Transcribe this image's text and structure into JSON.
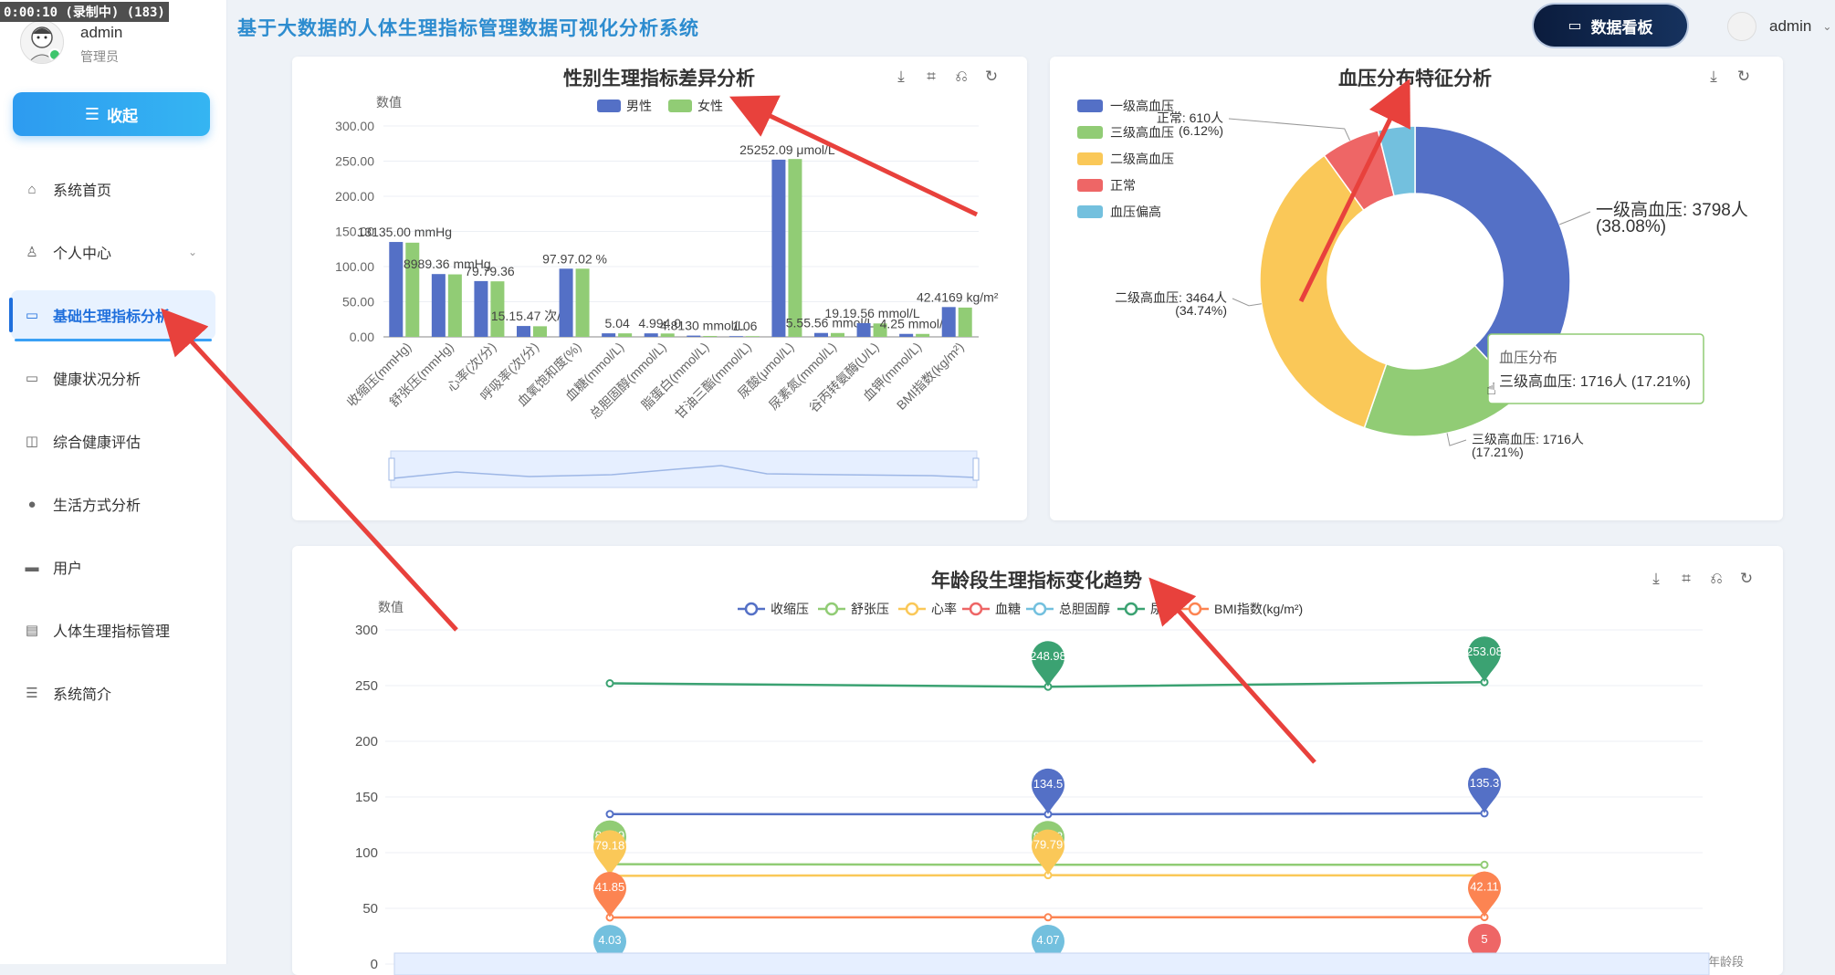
{
  "recording": "0:00:10 (录制中) (183)",
  "sidebar": {
    "user": {
      "name": "admin",
      "role": "管理员"
    },
    "collapse_label": "收起",
    "items": [
      {
        "label": "系统首页",
        "icon": "home-icon"
      },
      {
        "label": "个人中心",
        "icon": "user-icon",
        "has_submenu": true
      },
      {
        "label": "基础生理指标分析",
        "icon": "monitor-icon",
        "active": true
      },
      {
        "label": "健康状况分析",
        "icon": "monitor-icon"
      },
      {
        "label": "综合健康评估",
        "icon": "cup-icon"
      },
      {
        "label": "生活方式分析",
        "icon": "bulb-icon"
      },
      {
        "label": "用户",
        "icon": "briefcase-icon"
      },
      {
        "label": "人体生理指标管理",
        "icon": "document-icon"
      },
      {
        "label": "系统简介",
        "icon": "sliders-icon"
      }
    ]
  },
  "header": {
    "title": "基于大数据的人体生理指标管理数据可视化分析系统",
    "dashboard_button": "数据看板",
    "user_name": "admin"
  },
  "chart_data": [
    {
      "id": "gender",
      "type": "bar",
      "title": "性别生理指标差异分析",
      "ylabel": "数值",
      "ylim": [
        0,
        300
      ],
      "yticks": [
        "0.00",
        "50.00",
        "100.00",
        "150.00",
        "200.00",
        "250.00",
        "300.00"
      ],
      "categories": [
        "收缩压(mmHg)",
        "舒张压(mmHg)",
        "心率(次/分)",
        "呼吸率(次/分)",
        "血氧饱和度(%)",
        "血糖(mmol/L)",
        "总胆固醇(mmol/L)",
        "脂蛋白(mmol/L)",
        "甘油三酯(mmol/L)",
        "尿酸(μmol/L)",
        "尿素氮(mmol/L)",
        "谷丙转氨酶(U/L)",
        "血钾(mmol/L)",
        "BMI指数(kg/m²)"
      ],
      "series": [
        {
          "name": "男性",
          "color": "#5470c6",
          "values": [
            135.0,
            89.36,
            79.36,
            15.47,
            97.02,
            5.04,
            4.99,
            1.81,
            1.06,
            252.09,
            5.56,
            19.56,
            4.25,
            42.41
          ]
        },
        {
          "name": "女性",
          "color": "#91cc75",
          "values": [
            134.0,
            88.9,
            79.0,
            15.1,
            97.0,
            4.99,
            4.8,
            1.3,
            1.06,
            253.0,
            5.5,
            19.1,
            4.2,
            41.69
          ]
        }
      ],
      "labels": [
        "13135.00 mmHg",
        "8989.36 mmHg",
        "79.79.36",
        "15.15.47 次/分",
        "97.97.02 %",
        "5.04",
        "4.994.0",
        "4.8130 mmol/L",
        "1.06",
        "25252.09 μmol/L",
        "5.55.56 mmol/L",
        "19.19.56 mmol/L",
        "4.25 mmol/L",
        "42.4169 kg/m²"
      ],
      "legend_position": "top"
    },
    {
      "id": "bp",
      "type": "pie",
      "title": "血压分布特征分析",
      "tooltip_title": "血压分布",
      "tooltip_text": "三级高血压: 1716人 (17.21%)",
      "slices": [
        {
          "name": "一级高血压",
          "value": 3798,
          "percent": "38.08%",
          "color": "#5470c6",
          "label": "一级高血压: 3798人",
          "pct_label": "(38.08%)"
        },
        {
          "name": "三级高血压",
          "value": 1716,
          "percent": "17.21%",
          "color": "#91cc75",
          "label": "三级高血压: 1716人",
          "pct_label": "(17.21%)"
        },
        {
          "name": "二级高血压",
          "value": 3464,
          "percent": "34.74%",
          "color": "#fac858",
          "label": "二级高血压: 3464人",
          "pct_label": "(34.74%)"
        },
        {
          "name": "正常",
          "value": 610,
          "percent": "6.12%",
          "color": "#ee6666",
          "label": "正常: 610人",
          "pct_label": "(6.12%)"
        },
        {
          "name": "血压偏高",
          "value": 383,
          "percent": "3.85%",
          "color": "#73c0de"
        }
      ],
      "legend_position": "left"
    },
    {
      "id": "age",
      "type": "line",
      "title": "年龄段生理指标变化趋势",
      "ylabel": "数值",
      "xlabel": "年龄段",
      "ylim": [
        0,
        300
      ],
      "yticks": [
        "0",
        "50",
        "100",
        "150",
        "200",
        "250",
        "300"
      ],
      "series": [
        {
          "name": "收缩压",
          "color": "#5470c6",
          "values": [
            134.6,
            134.5,
            135.3
          ]
        },
        {
          "name": "舒张压",
          "color": "#91cc75",
          "values": [
            89.69,
            89.13,
            89.1
          ]
        },
        {
          "name": "心率",
          "color": "#fac858",
          "values": [
            79.18,
            79.79,
            79.5
          ]
        },
        {
          "name": "血糖",
          "color": "#ee6666",
          "values": [
            4.9,
            4.95,
            5
          ]
        },
        {
          "name": "总胆固醇",
          "color": "#73c0de",
          "values": [
            4.03,
            4.07,
            4.1
          ]
        },
        {
          "name": "尿酸",
          "color": "#3ba272",
          "values": [
            252.0,
            248.98,
            253.08
          ]
        },
        {
          "name": "BMI指数(kg/m²)",
          "color": "#fc8452",
          "values": [
            41.85,
            42.0,
            42.11
          ]
        }
      ],
      "pin_labels": {
        "green_mid": "248.98",
        "green_right": "253.08",
        "blue_mid": "134.5",
        "blue_right": "135.3",
        "light_left": "89.69",
        "yellow_left": "79.18",
        "light_mid": "89.13",
        "yellow_mid": "79.79",
        "orange_left": "41.85",
        "orange_right": "42.11",
        "teal_left": "4.03",
        "teal_mid": "4.07",
        "red_right": "5"
      },
      "legend_position": "top"
    }
  ]
}
